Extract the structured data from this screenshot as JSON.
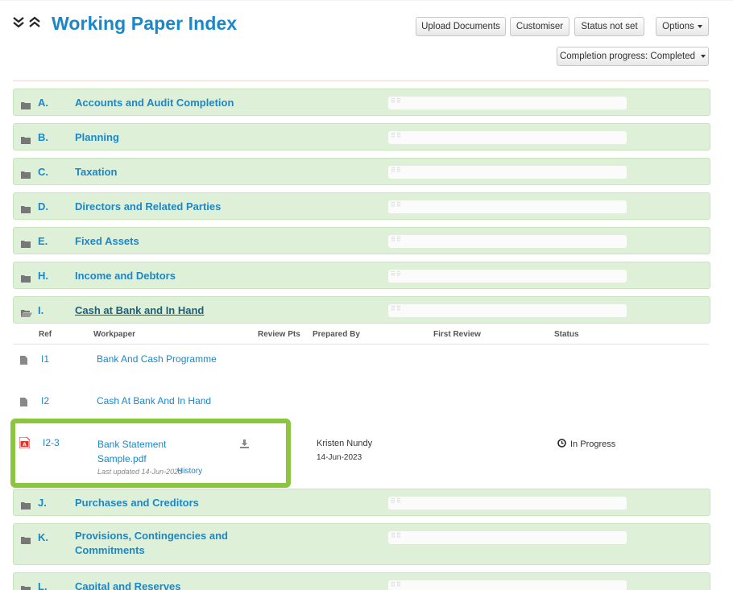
{
  "page": {
    "title": "Working Paper Index"
  },
  "toolbar": {
    "upload_label": "Upload Documents",
    "customiser_label": "Customiser",
    "status_label": "Status not set",
    "options_label": "Options",
    "completion_label": "Completion progress: Completed"
  },
  "sections": [
    {
      "letter": "A.",
      "name": "Accounts and Audit Completion"
    },
    {
      "letter": "B.",
      "name": "Planning"
    },
    {
      "letter": "C.",
      "name": "Taxation"
    },
    {
      "letter": "D.",
      "name": "Directors and Related Parties"
    },
    {
      "letter": "E.",
      "name": "Fixed Assets"
    },
    {
      "letter": "H.",
      "name": "Income and Debtors"
    },
    {
      "letter": "I.",
      "name": "Cash at Bank and In Hand"
    },
    {
      "letter": "J.",
      "name": "Purchases and Creditors"
    },
    {
      "letter": "K.",
      "name": "Provisions, Contingencies and Commitments"
    },
    {
      "letter": "L.",
      "name": "Capital and Reserves"
    }
  ],
  "table": {
    "headers": [
      "Ref",
      "Workpaper",
      "Review Pts",
      "Prepared By",
      "First Review",
      "Status"
    ],
    "rows": [
      {
        "ref": "I1",
        "workpaper": "Bank And Cash Programme"
      },
      {
        "ref": "I2",
        "workpaper": "Cash At Bank And In Hand"
      },
      {
        "ref": "I2-3",
        "workpaper": "Bank Statement Sample.pdf",
        "last_updated": "Last updated 14-Jun-2023",
        "history_label": "History",
        "prepared_by": "Kristen Nundy",
        "prepared_date": "14-Jun-2023",
        "status": "In Progress"
      }
    ]
  },
  "icons": {
    "collapse": "double-chevron-down-icon",
    "expand": "double-chevron-up-icon",
    "folder": "folder-icon",
    "folder_open": "folder-open-icon",
    "document": "document-icon",
    "pdf": "pdf-icon",
    "download": "download-icon",
    "status": "clock-icon"
  },
  "colors": {
    "accent": "#1a87c9",
    "section_bg": "#dff0d8",
    "highlight": "#8cc63f"
  }
}
